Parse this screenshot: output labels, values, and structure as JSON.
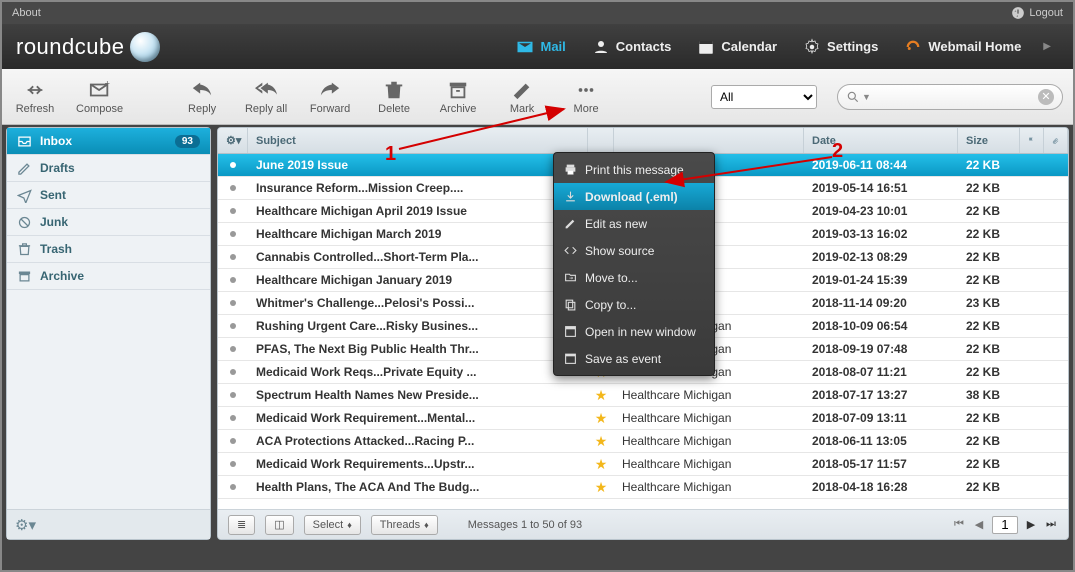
{
  "topbar": {
    "about": "About",
    "logout": "Logout"
  },
  "logo": "roundcube",
  "topnav": [
    {
      "id": "mail",
      "label": "Mail",
      "active": true
    },
    {
      "id": "contacts",
      "label": "Contacts"
    },
    {
      "id": "calendar",
      "label": "Calendar"
    },
    {
      "id": "settings",
      "label": "Settings"
    },
    {
      "id": "webmailhome",
      "label": "Webmail Home"
    }
  ],
  "toolbar": {
    "refresh": "Refresh",
    "compose": "Compose",
    "reply": "Reply",
    "replyall": "Reply all",
    "forward": "Forward",
    "delete": "Delete",
    "archive": "Archive",
    "mark": "Mark",
    "more": "More"
  },
  "scope_options": [
    "All"
  ],
  "scope_selected": "All",
  "search_placeholder": "",
  "folders": [
    {
      "id": "inbox",
      "label": "Inbox",
      "badge": "93",
      "selected": true
    },
    {
      "id": "drafts",
      "label": "Drafts"
    },
    {
      "id": "sent",
      "label": "Sent"
    },
    {
      "id": "junk",
      "label": "Junk"
    },
    {
      "id": "trash",
      "label": "Trash"
    },
    {
      "id": "archive",
      "label": "Archive"
    }
  ],
  "columns": {
    "subject": "Subject",
    "from": "",
    "date": "Date",
    "size": "Size"
  },
  "messages": [
    {
      "subject": "June 2019 Issue",
      "from": "",
      "date": "2019-06-11 08:44",
      "size": "22 KB",
      "starred": false,
      "selected": true
    },
    {
      "subject": "Insurance Reform...Mission Creep....",
      "from": "",
      "date": "2019-05-14 16:51",
      "size": "22 KB",
      "starred": false
    },
    {
      "subject": "Healthcare Michigan April 2019 Issue",
      "from": "",
      "date": "2019-04-23 10:01",
      "size": "22 KB",
      "starred": false
    },
    {
      "subject": "Healthcare Michigan March 2019",
      "from": "",
      "date": "2019-03-13 16:02",
      "size": "22 KB",
      "starred": false
    },
    {
      "subject": "Cannabis Controlled...Short-Term Pla...",
      "from": "",
      "date": "2019-02-13 08:29",
      "size": "22 KB",
      "starred": false
    },
    {
      "subject": "Healthcare Michigan January 2019",
      "from": "",
      "date": "2019-01-24 15:39",
      "size": "22 KB",
      "starred": false
    },
    {
      "subject": "Whitmer's Challenge...Pelosi's Possi...",
      "from": "",
      "date": "2018-11-14 09:20",
      "size": "23 KB",
      "starred": false
    },
    {
      "subject": "Rushing Urgent Care...Risky Busines...",
      "from": "Healthcare Michigan",
      "date": "2018-10-09 06:54",
      "size": "22 KB",
      "starred": true
    },
    {
      "subject": "PFAS, The Next Big Public Health Thr...",
      "from": "Healthcare Michigan",
      "date": "2018-09-19 07:48",
      "size": "22 KB",
      "starred": true
    },
    {
      "subject": "Medicaid Work Reqs...Private Equity ...",
      "from": "Healthcare Michigan",
      "date": "2018-08-07 11:21",
      "size": "22 KB",
      "starred": true
    },
    {
      "subject": "Spectrum Health Names New Preside...",
      "from": "Healthcare Michigan",
      "date": "2018-07-17 13:27",
      "size": "38 KB",
      "starred": true
    },
    {
      "subject": "Medicaid Work Requirement...Mental...",
      "from": "Healthcare Michigan",
      "date": "2018-07-09 13:11",
      "size": "22 KB",
      "starred": true
    },
    {
      "subject": "ACA Protections Attacked...Racing P...",
      "from": "Healthcare Michigan",
      "date": "2018-06-11 13:05",
      "size": "22 KB",
      "starred": true
    },
    {
      "subject": "Medicaid Work Requirements...Upstr...",
      "from": "Healthcare Michigan",
      "date": "2018-05-17 11:57",
      "size": "22 KB",
      "starred": true
    },
    {
      "subject": "Health Plans, The ACA And The Budg...",
      "from": "Healthcare Michigan",
      "date": "2018-04-18 16:28",
      "size": "22 KB",
      "starred": true
    }
  ],
  "contextmenu": [
    {
      "id": "print",
      "label": "Print this message"
    },
    {
      "id": "download",
      "label": "Download (.eml)",
      "highlight": true
    },
    {
      "id": "editnew",
      "label": "Edit as new"
    },
    {
      "id": "source",
      "label": "Show source"
    },
    {
      "id": "moveto",
      "label": "Move to..."
    },
    {
      "id": "copyto",
      "label": "Copy to..."
    },
    {
      "id": "openwin",
      "label": "Open in new window"
    },
    {
      "id": "saveevent",
      "label": "Save as event"
    }
  ],
  "listfoot": {
    "select": "Select",
    "threads": "Threads",
    "status": "Messages 1 to 50 of 93",
    "page": "1"
  },
  "annotations": {
    "n1": "1",
    "n2": "2"
  }
}
